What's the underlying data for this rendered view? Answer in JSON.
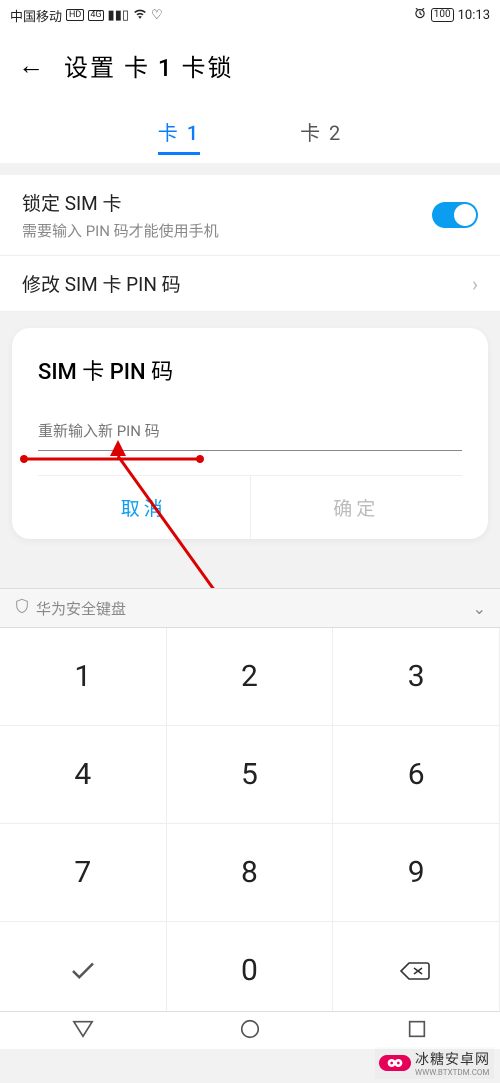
{
  "statusbar": {
    "carrier": "中国移动",
    "hd": "HD",
    "signal_4g": "4G",
    "time": "10:13",
    "battery": "100"
  },
  "header": {
    "back_glyph": "←",
    "title": "设置 卡 1 卡锁"
  },
  "tabs": {
    "tab1": "卡 1",
    "tab2": "卡 2"
  },
  "settings": {
    "lock_title": "锁定 SIM 卡",
    "lock_sub": "需要输入 PIN 码才能使用手机",
    "change_pin": "修改 SIM 卡 PIN 码"
  },
  "dialog": {
    "title": "SIM 卡 PIN 码",
    "placeholder": "重新输入新 PIN 码",
    "cancel": "取消",
    "ok": "确定"
  },
  "keyboard": {
    "bar_label": "华为安全键盘",
    "k1": "1",
    "k2": "2",
    "k3": "3",
    "k4": "4",
    "k5": "5",
    "k6": "6",
    "k7": "7",
    "k8": "8",
    "k9": "9",
    "k0": "0"
  },
  "watermark": {
    "cn": "冰糖安卓网",
    "en": "WWW.BTXTDM.COM"
  }
}
